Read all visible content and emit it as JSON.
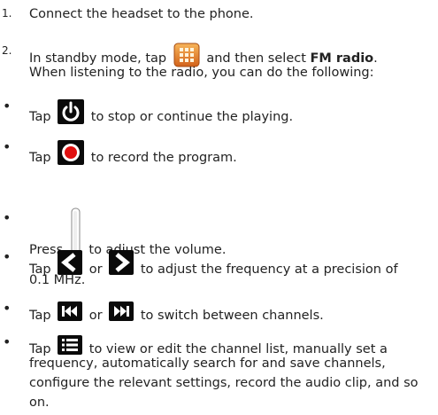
{
  "steps": [
    {
      "num": "1.",
      "text": "Connect the headset to the phone."
    },
    {
      "num": "2.",
      "before": "In standby mode, tap",
      "middle": "and then select",
      "bold": "FM radio",
      "after": ".",
      "line2": "When listening to the radio, you can do the following:"
    }
  ],
  "bullets": {
    "power": {
      "pre": "Tap",
      "post": "to stop or continue the playing.",
      "icon": "power-icon"
    },
    "record": {
      "pre": "Tap",
      "post": "to record the program.",
      "icon": "record-icon"
    },
    "volume": {
      "pre": "Press",
      "post": "to adjust the volume.",
      "icon": "volume-key-icon"
    },
    "freq": {
      "pre": "Tap",
      "or": "or",
      "post": "to adjust the frequency at a precision of",
      "line2": "0.1 MHz.",
      "icons": [
        "chevron-left-icon",
        "chevron-right-icon"
      ]
    },
    "channel": {
      "pre": "Tap",
      "or": "or",
      "post": "to switch between channels.",
      "icons": [
        "skip-previous-icon",
        "skip-next-icon"
      ]
    },
    "list": {
      "pre": "Tap",
      "post": "to view or edit the channel list, manually set a",
      "line2": "frequency, automatically search for and save channels,",
      "line3": "configure the relevant settings, record the audio clip, and so",
      "line4": "on.",
      "icon": "list-icon"
    }
  },
  "bullet_char": "•",
  "colors": {
    "text": "#222222",
    "record_red": "#e01010",
    "menu_orange": "#e8821e"
  }
}
